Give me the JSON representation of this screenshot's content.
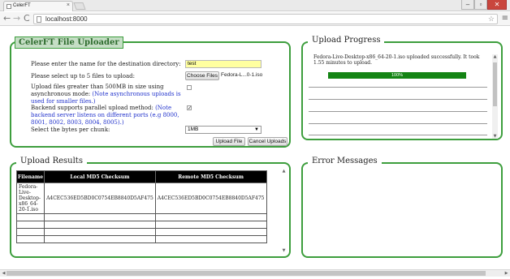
{
  "browser": {
    "tab_title": "CelerFT",
    "tab_close": "×",
    "url": "localhost:8000",
    "back": "←",
    "forward": "→",
    "reload": "C",
    "star": "☆",
    "menu": "≡",
    "win_min": "–",
    "win_max": "▫",
    "win_close": "✕"
  },
  "uploader": {
    "title": "CelerFT File Uploader",
    "dest_label": "Please enter the name for the destination directory:",
    "dest_value": "test",
    "select_files_label": "Please select up to 5 files to upload:",
    "choose_files_button": "Choose Files",
    "chosen_file": "Fedora-L...0-1.iso",
    "async_label": "Upload files greater than 500MB in size using asynchronous mode:",
    "async_note": "(Note asynchronous uploads is used for smaller files.)",
    "async_checked": false,
    "parallel_label": "Backend supports parallel upload method:",
    "parallel_note": "(Note backend server listens on different ports (e.g 8000, 8001, 8002, 8003, 8004, 8005).)",
    "parallel_checked": true,
    "chunk_label": "Select the bytes per chunk:",
    "chunk_value": "1MB",
    "upload_button": "Upload File",
    "cancel_button": "Cancel Uploads"
  },
  "progress": {
    "title": "Upload Progress",
    "message": "Fedora-Live-Desktop-x86_64-20-1.iso uploaded successfully. It took 1.55 minutes to upload.",
    "percent": 100,
    "percent_label": "100%"
  },
  "results": {
    "title": "Upload Results",
    "columns": [
      "Filename",
      "Local MD5 Checksum",
      "Remote MD5 Checksum"
    ],
    "rows": [
      [
        "Fedora-Live-Desktop-x86_64-20-1.iso",
        "A4CEC536ED5BD0C0754EB8840D5AF475",
        "A4CEC536ED5BD0C0754EB8840D5AF475"
      ],
      [
        "",
        "",
        ""
      ],
      [
        "",
        "",
        ""
      ],
      [
        "",
        "",
        ""
      ],
      [
        "",
        "",
        ""
      ]
    ]
  },
  "errors": {
    "title": "Error Messages"
  },
  "colors": {
    "panel_border": "#3d9e3d",
    "progress_fill": "#148414",
    "input_bg": "#ffffa0",
    "note_text": "#2233cc"
  }
}
